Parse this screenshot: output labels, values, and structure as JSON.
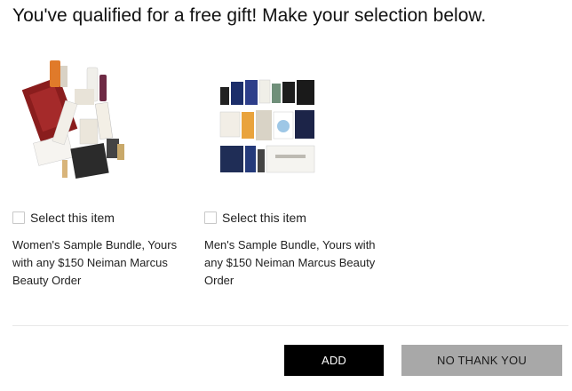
{
  "heading": "You've qualified for a free gift! Make your selection below.",
  "items": [
    {
      "select_label": "Select this item",
      "description": "Women's Sample Bundle, Yours with any $150 Neiman Marcus Beauty Order",
      "checked": false
    },
    {
      "select_label": "Select this item",
      "description": "Men's Sample Bundle, Yours with any $150 Neiman Marcus Beauty Order",
      "checked": false
    }
  ],
  "actions": {
    "add_label": "ADD",
    "decline_label": "NO THANK YOU"
  },
  "colors": {
    "add_bg": "#000000",
    "decline_bg": "#a8a8a8"
  }
}
